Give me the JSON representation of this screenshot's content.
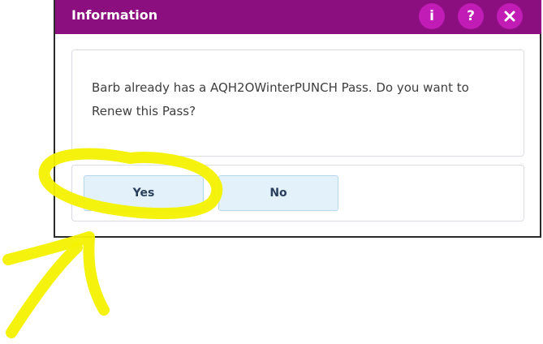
{
  "dialog": {
    "title": "Information",
    "title_buttons": [
      {
        "label": "i",
        "icon": "info-icon"
      },
      {
        "label": "?",
        "icon": "help-icon"
      },
      {
        "icon": "close-icon"
      }
    ],
    "message": "Barb already has a AQH2OWinterPUNCH Pass. Do you want to Renew this Pass?",
    "buttons": {
      "yes_label": "Yes",
      "no_label": "No"
    }
  },
  "colors": {
    "titlebar": "#8b0f7e",
    "title_button": "#c21cb6",
    "button_bg": "#e3f1fa",
    "annotation_highlight": "#f4f200"
  }
}
